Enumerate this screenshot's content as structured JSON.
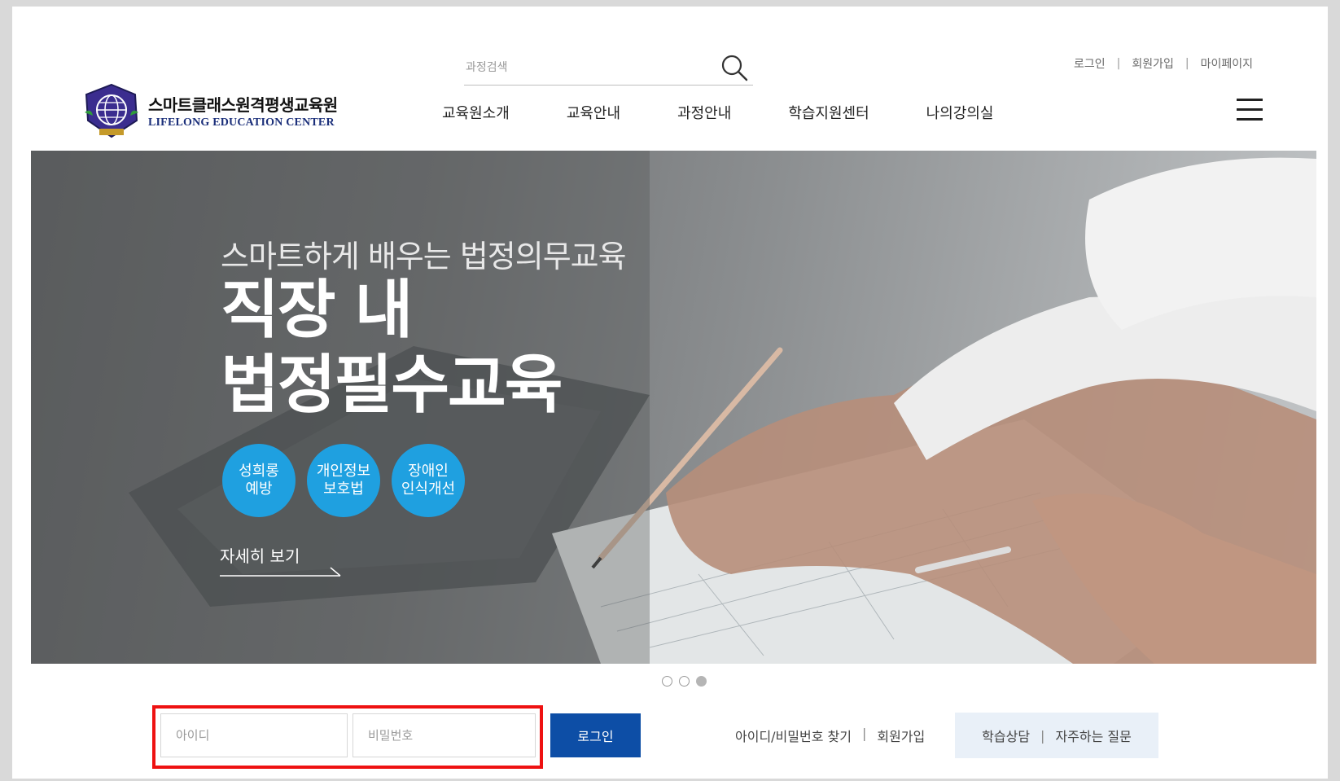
{
  "header": {
    "logo": {
      "title_ko": "스마트클래스원격평생교육원",
      "title_en": "LIFELONG EDUCATION CENTER"
    },
    "search": {
      "placeholder": "과정검색"
    },
    "util_links": [
      "로그인",
      "회원가입",
      "마이페이지"
    ],
    "util_separator": "|",
    "nav": [
      "교육원소개",
      "교육안내",
      "과정안내",
      "학습지원센터",
      "나의강의실"
    ]
  },
  "hero": {
    "subtitle": "스마트하게 배우는 법정의무교육",
    "title_line1": "직장 내",
    "title_line2": "법정필수교육",
    "badges": [
      {
        "line1": "성희롱",
        "line2": "예방"
      },
      {
        "line1": "개인정보",
        "line2": "보호법"
      },
      {
        "line1": "장애인",
        "line2": "인식개선"
      }
    ],
    "more_label": "자세히 보기",
    "badge_color": "#1fa0e0"
  },
  "slider": {
    "total": 3,
    "active_index": 3
  },
  "login": {
    "id_placeholder": "아이디",
    "pw_placeholder": "비밀번호",
    "button_label": "로그인",
    "button_color": "#0d4ea6",
    "find_label": "아이디/비밀번호 찾기",
    "join_label": "회원가입",
    "separator": "|"
  },
  "help": {
    "consult_label": "학습상담",
    "faq_label": "자주하는 질문",
    "separator": "|"
  }
}
